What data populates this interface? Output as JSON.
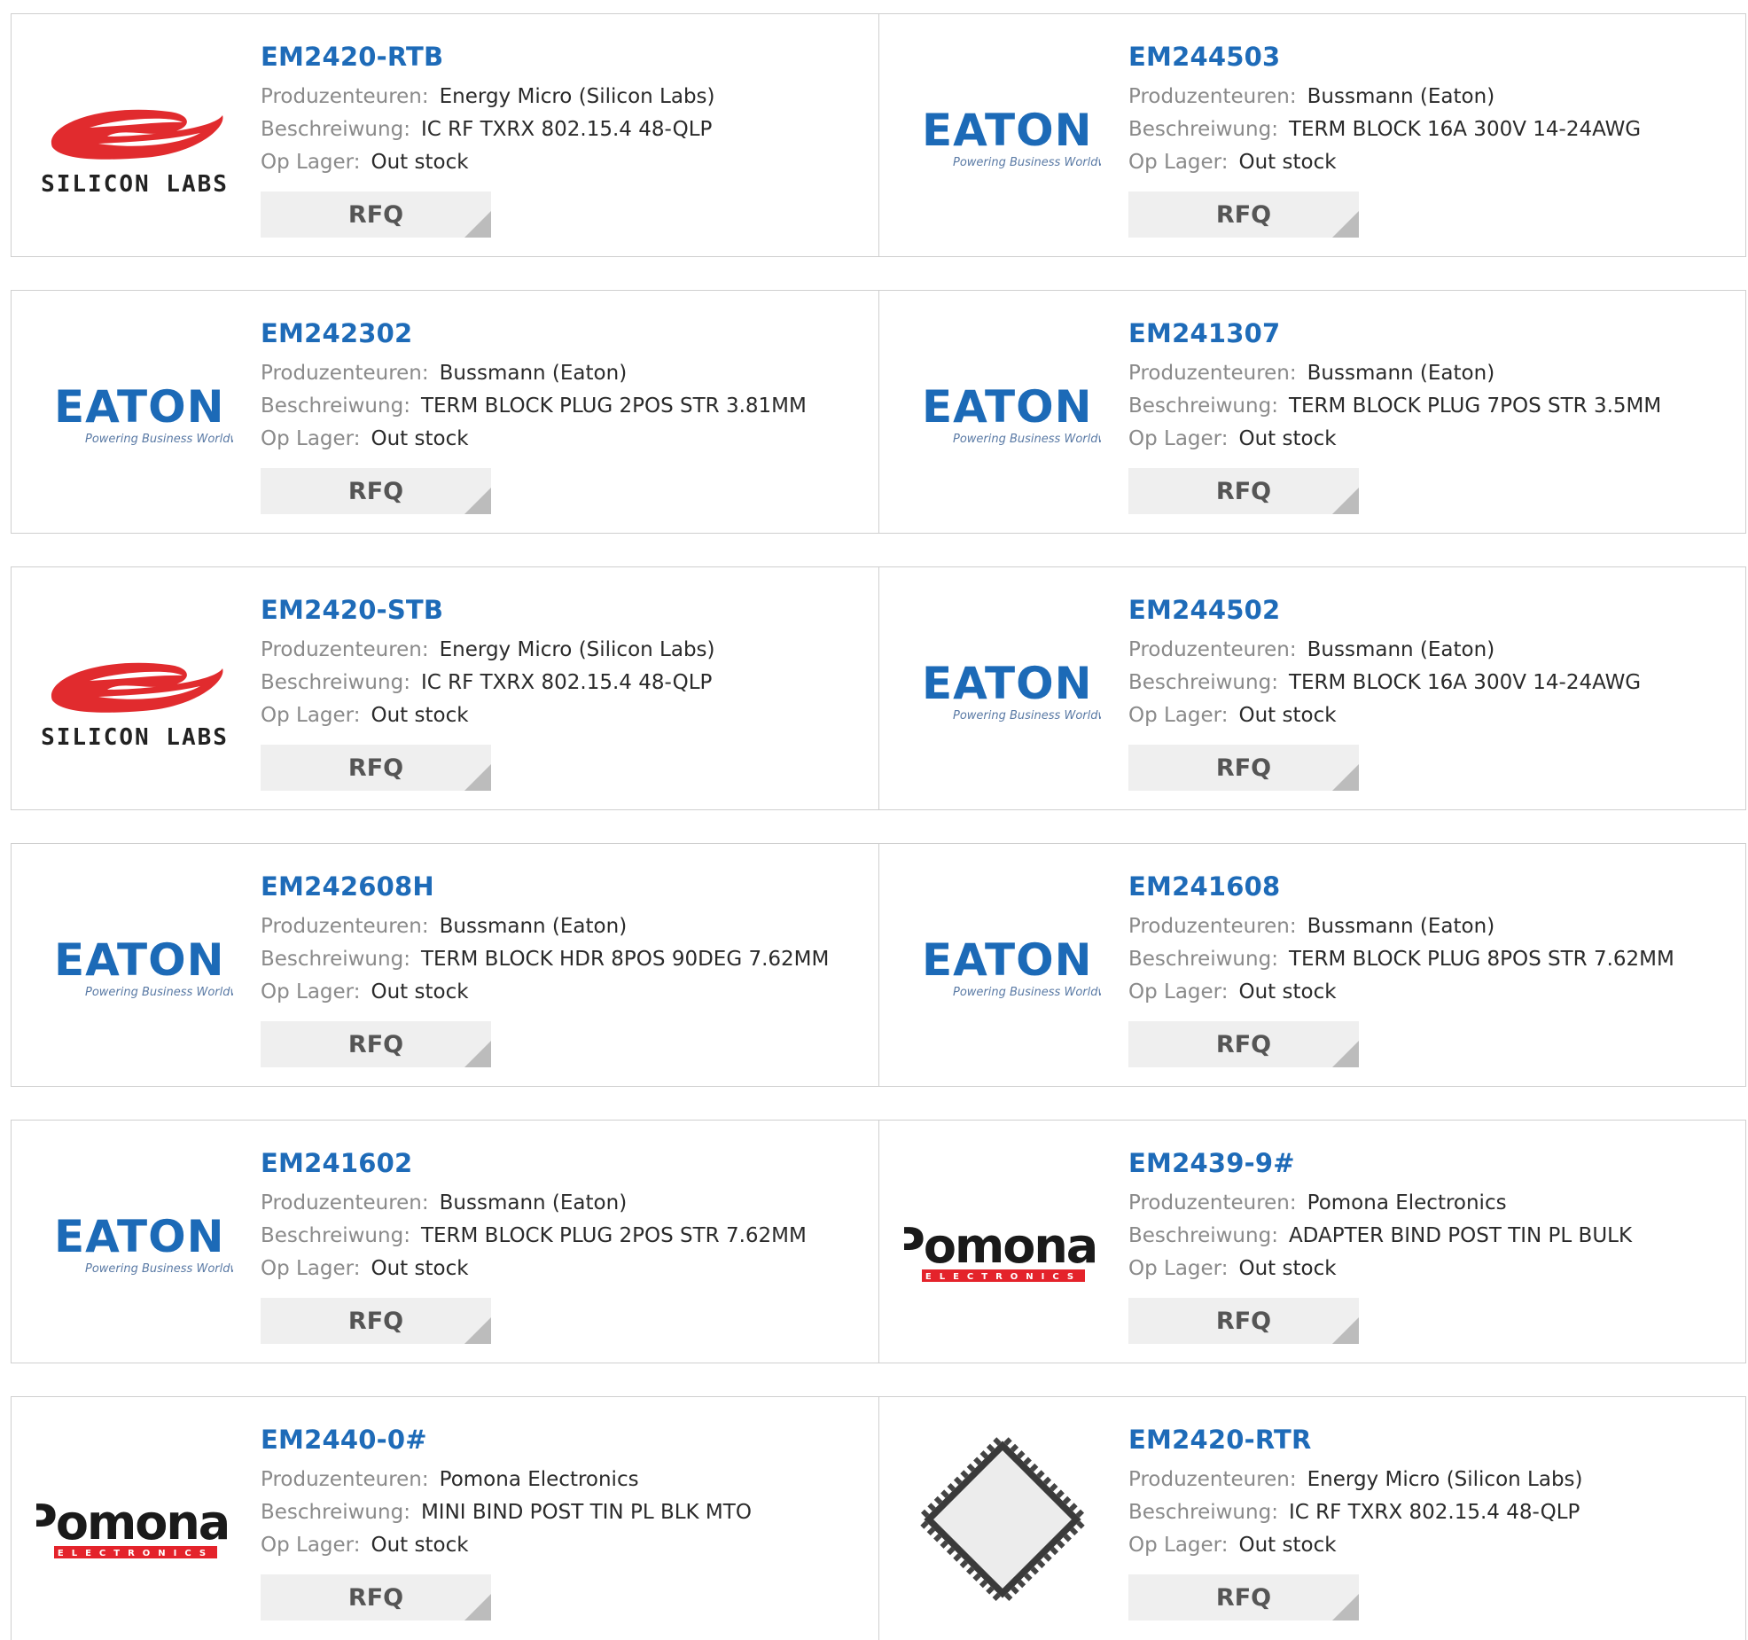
{
  "labels": {
    "manufacturer": "Produzenteuren:",
    "description": "Beschreiwung:",
    "stock": "Op Lager:",
    "rfq": "RFQ"
  },
  "logos": {
    "silicon_labs": {
      "text": "SILICON LABS",
      "color": "#e12b2e"
    },
    "eaton": {
      "text": "EATON",
      "tagline": "Powering Business Worldwide",
      "color": "#1c6ab7"
    },
    "pomona": {
      "text": "Pomona.",
      "sub": "ELECTRONICS",
      "color": "#e4232b"
    },
    "chip": {
      "name": "qfn-chip"
    }
  },
  "products": [
    {
      "part": "EM2420-RTB",
      "manufacturer": "Energy Micro (Silicon Labs)",
      "description": "IC RF TXRX 802.15.4 48-QLP",
      "stock": "Out stock",
      "logo": "silicon_labs"
    },
    {
      "part": "EM244503",
      "manufacturer": "Bussmann (Eaton)",
      "description": "TERM BLOCK 16A 300V 14-24AWG",
      "stock": "Out stock",
      "logo": "eaton"
    },
    {
      "part": "EM242302",
      "manufacturer": "Bussmann (Eaton)",
      "description": "TERM BLOCK PLUG 2POS STR 3.81MM",
      "stock": "Out stock",
      "logo": "eaton"
    },
    {
      "part": "EM241307",
      "manufacturer": "Bussmann (Eaton)",
      "description": "TERM BLOCK PLUG 7POS STR 3.5MM",
      "stock": "Out stock",
      "logo": "eaton"
    },
    {
      "part": "EM2420-STB",
      "manufacturer": "Energy Micro (Silicon Labs)",
      "description": "IC RF TXRX 802.15.4 48-QLP",
      "stock": "Out stock",
      "logo": "silicon_labs"
    },
    {
      "part": "EM244502",
      "manufacturer": "Bussmann (Eaton)",
      "description": "TERM BLOCK 16A 300V 14-24AWG",
      "stock": "Out stock",
      "logo": "eaton"
    },
    {
      "part": "EM242608H",
      "manufacturer": "Bussmann (Eaton)",
      "description": "TERM BLOCK HDR 8POS 90DEG 7.62MM",
      "stock": "Out stock",
      "logo": "eaton"
    },
    {
      "part": "EM241608",
      "manufacturer": "Bussmann (Eaton)",
      "description": "TERM BLOCK PLUG 8POS STR 7.62MM",
      "stock": "Out stock",
      "logo": "eaton"
    },
    {
      "part": "EM241602",
      "manufacturer": "Bussmann (Eaton)",
      "description": "TERM BLOCK PLUG 2POS STR 7.62MM",
      "stock": "Out stock",
      "logo": "eaton"
    },
    {
      "part": "EM2439-9#",
      "manufacturer": "Pomona Electronics",
      "description": "ADAPTER BIND POST TIN PL BULK",
      "stock": "Out stock",
      "logo": "pomona"
    },
    {
      "part": "EM2440-0#",
      "manufacturer": "Pomona Electronics",
      "description": "MINI BIND POST TIN PL BLK MTO",
      "stock": "Out stock",
      "logo": "pomona"
    },
    {
      "part": "EM2420-RTR",
      "manufacturer": "Energy Micro (Silicon Labs)",
      "description": "IC RF TXRX 802.15.4 48-QLP",
      "stock": "Out stock",
      "logo": "chip"
    }
  ]
}
